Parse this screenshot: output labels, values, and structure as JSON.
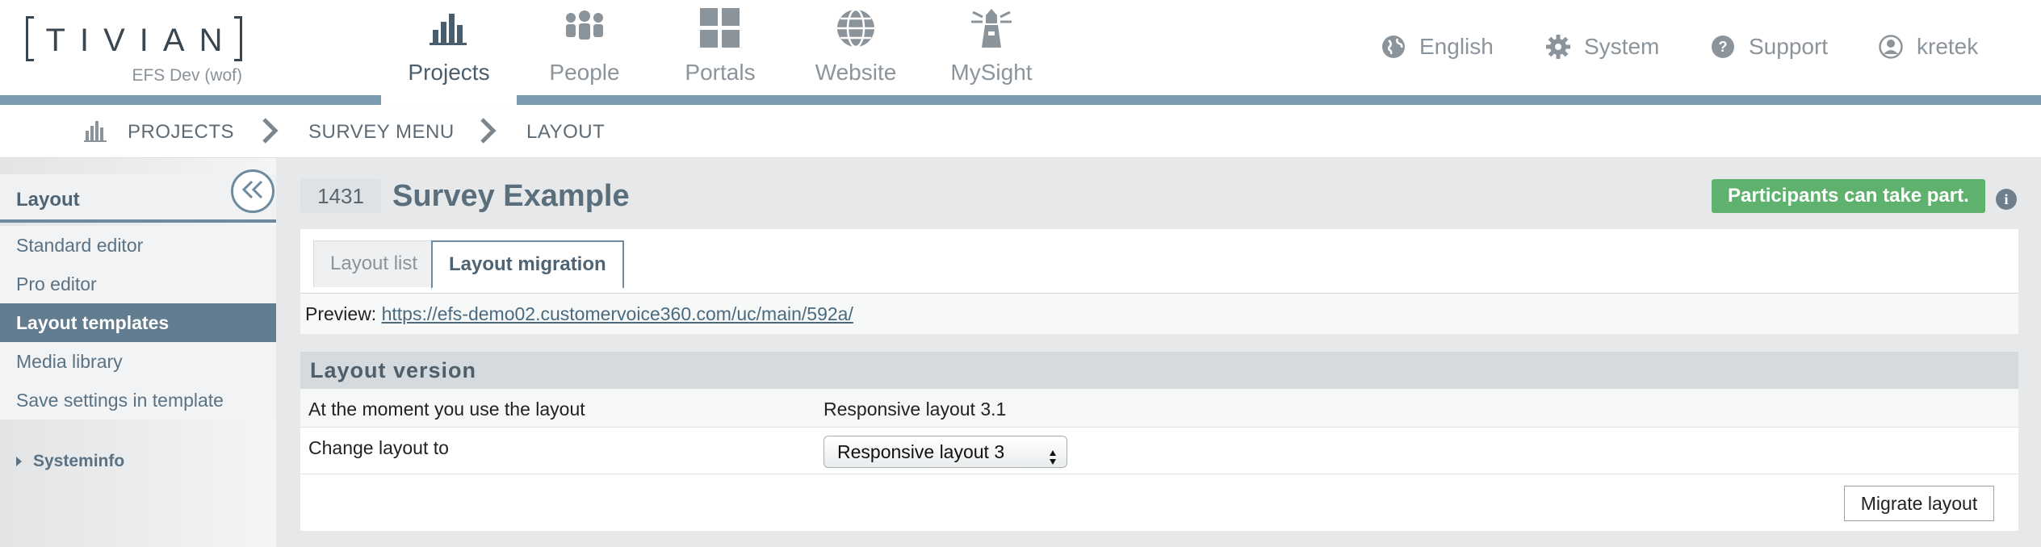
{
  "header": {
    "logo_text": "TIVIAN",
    "env_label": "EFS Dev (wof)",
    "nav": [
      {
        "label": "Projects",
        "icon": "bar-chart-icon",
        "active": true
      },
      {
        "label": "People",
        "icon": "people-icon",
        "active": false
      },
      {
        "label": "Portals",
        "icon": "grid-icon",
        "active": false
      },
      {
        "label": "Website",
        "icon": "globe-icon",
        "active": false
      },
      {
        "label": "MySight",
        "icon": "lighthouse-icon",
        "active": false
      }
    ],
    "utilities": [
      {
        "label": "English",
        "icon": "globe-small-icon"
      },
      {
        "label": "System",
        "icon": "gear-icon"
      },
      {
        "label": "Support",
        "icon": "help-icon"
      },
      {
        "label": "kretek",
        "icon": "user-icon"
      }
    ]
  },
  "breadcrumb": [
    "PROJECTS",
    "SURVEY MENU",
    "LAYOUT"
  ],
  "sidebar": {
    "title": "Layout",
    "items": [
      {
        "label": "Standard editor",
        "active": false
      },
      {
        "label": "Pro editor",
        "active": false
      },
      {
        "label": "Layout templates",
        "active": true
      },
      {
        "label": "Media library",
        "active": false
      },
      {
        "label": "Save settings in template",
        "active": false
      }
    ],
    "systeminfo": "Systeminfo"
  },
  "main": {
    "survey_id": "1431",
    "survey_title": "Survey Example",
    "status": "Participants can take part.",
    "tabs": [
      "Layout list",
      "Layout migration"
    ],
    "preview_label": "Preview:",
    "preview_url": "https://efs-demo02.customervoice360.com/uc/main/592a/",
    "section_title": "Layout version",
    "current_layout_label": "At the moment you use the layout",
    "current_layout_value": "Responsive layout 3.1",
    "change_layout_label": "Change layout to",
    "change_layout_value": "Responsive layout 3",
    "migrate_button": "Migrate layout"
  },
  "colors": {
    "accent": "#6d8a9e",
    "status_green": "#5fb26e",
    "sidebar_active": "#627d90"
  }
}
